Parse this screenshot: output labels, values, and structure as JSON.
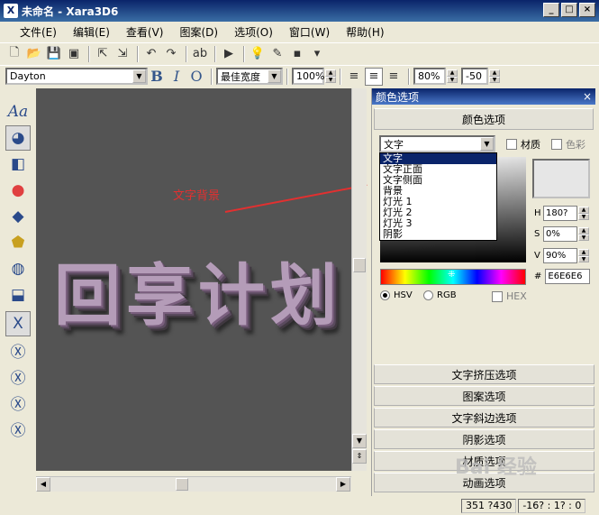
{
  "window": {
    "title": "未命名 - Xara3D6",
    "app_icon": "xara-icon",
    "controls": {
      "minimize": "_",
      "maximize": "□",
      "close": "×"
    }
  },
  "menu": [
    "文件(E)",
    "编辑(E)",
    "查看(V)",
    "图案(D)",
    "选项(O)",
    "窗口(W)",
    "帮助(H)"
  ],
  "toolbar2": {
    "font": "Dayton",
    "bold": "B",
    "italic": "I",
    "outline": "O",
    "width_mode": "最佳宽度",
    "zoom": "100%",
    "line_spacing": "80%",
    "char_spacing": "-50"
  },
  "canvas": {
    "text": "回享计划",
    "annotation": "文字背景",
    "annotation_color": "#e23030",
    "background_color": "#545454"
  },
  "panel": {
    "title": "颜色选项",
    "close": "×",
    "section_open": "颜色选项",
    "dropdown_value": "文字",
    "dropdown_options": [
      "文字",
      "文字正面",
      "文字侧面",
      "背景",
      "灯光 1",
      "灯光 2",
      "灯光 3",
      "阴影"
    ],
    "material_label": "材质",
    "color_label": "色彩",
    "h_label": "H",
    "h_value": "180?",
    "s_label": "S",
    "s_value": "0%",
    "v_label": "V",
    "v_value": "90%",
    "hex_prefix": "#",
    "hex_value": "E6E6E6",
    "hsv_label": "HSV",
    "rgb_label": "RGB",
    "hex_label": "HEX",
    "preview_color": "#e6e6e6",
    "sections": [
      "文字挤压选项",
      "图案选项",
      "文字斜边选项",
      "阴影选项",
      "材质选项",
      "动画选项"
    ]
  },
  "status": [
    "351 ?430",
    "-16? : 1? : 0"
  ],
  "watermark": "Bai 经验"
}
